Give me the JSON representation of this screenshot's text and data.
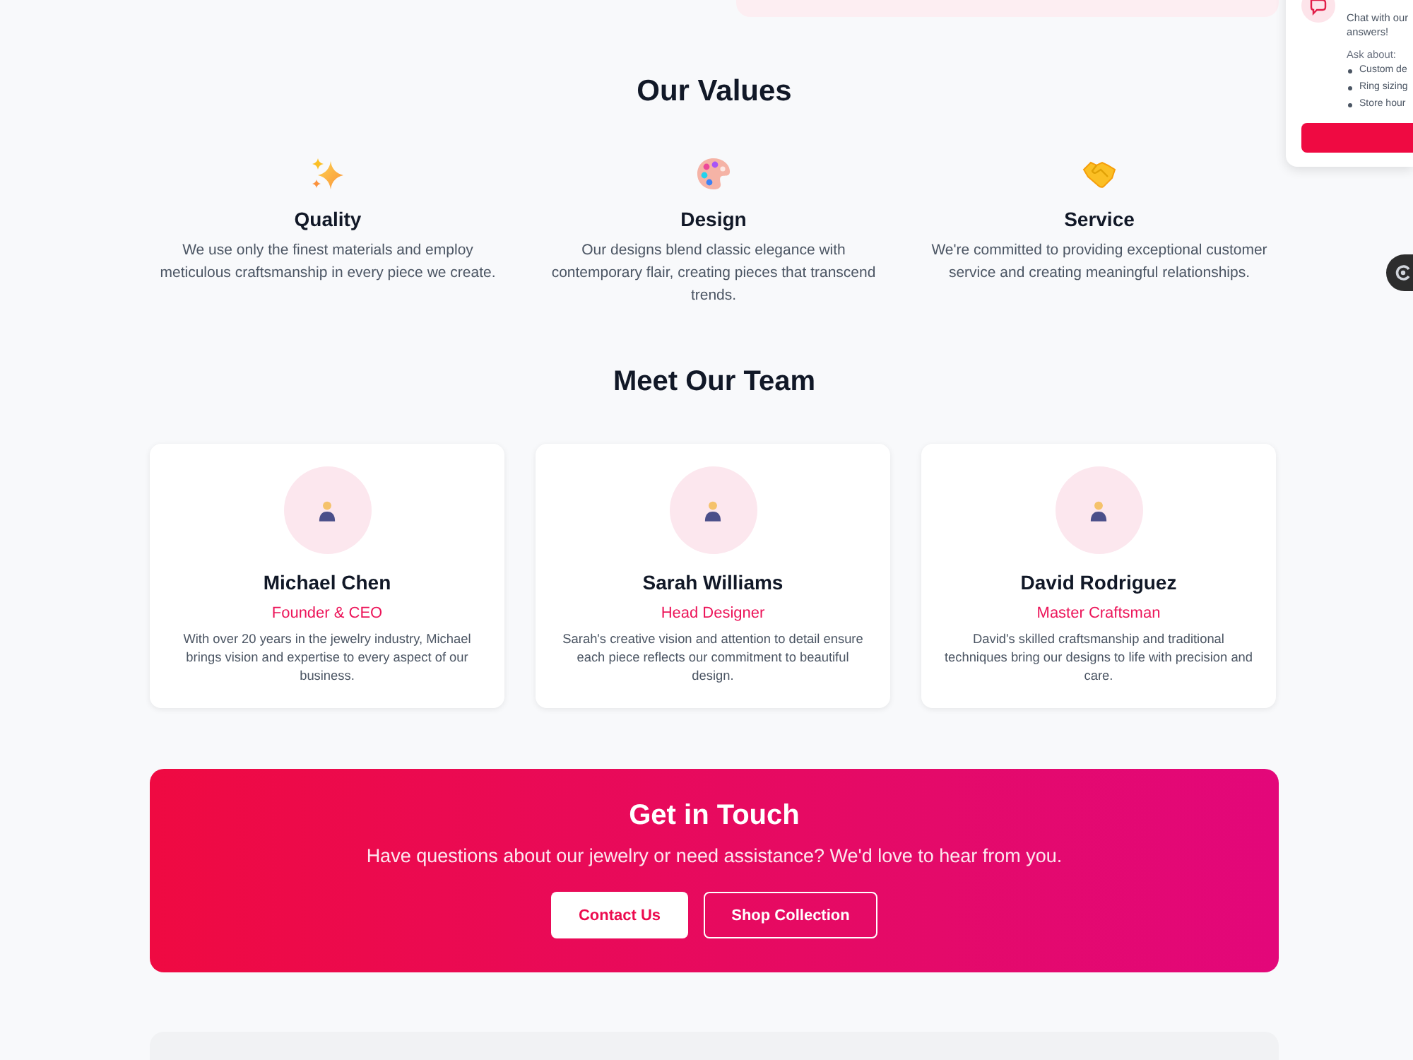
{
  "chat_popup": {
    "message_lines": [
      "Chat with our",
      "answers!"
    ],
    "ask_label": "Ask about:",
    "topics": [
      "Custom de",
      "Ring sizing",
      "Store hour"
    ]
  },
  "values": {
    "title": "Our Values",
    "items": [
      {
        "title": "Quality",
        "text": "We use only the finest materials and employ meticulous craftsmanship in every piece we create."
      },
      {
        "title": "Design",
        "text": "Our designs blend classic elegance with contemporary flair, creating pieces that transcend trends."
      },
      {
        "title": "Service",
        "text": "We're committed to providing exceptional customer service and creating meaningful relationships."
      }
    ]
  },
  "team": {
    "title": "Meet Our Team",
    "members": [
      {
        "name": "Michael Chen",
        "role": "Founder & CEO",
        "bio": "With over 20 years in the jewelry industry, Michael brings vision and expertise to every aspect of our business."
      },
      {
        "name": "Sarah Williams",
        "role": "Head Designer",
        "bio": "Sarah's creative vision and attention to detail ensure each piece reflects our commitment to beautiful design."
      },
      {
        "name": "David Rodriguez",
        "role": "Master Craftsman",
        "bio": "David's skilled craftsmanship and traditional techniques bring our designs to life with precision and care."
      }
    ]
  },
  "contact": {
    "title": "Get in Touch",
    "text": "Have questions about our jewelry or need assistance? We'd love to hear from you.",
    "buttons": [
      {
        "label": "Contact Us",
        "kind": "primary"
      },
      {
        "label": "Shop Collection",
        "kind": "outline"
      }
    ]
  }
}
